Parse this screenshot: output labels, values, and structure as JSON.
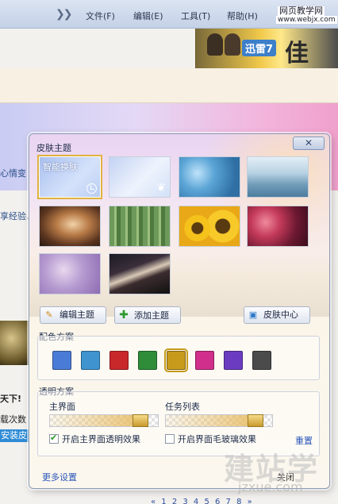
{
  "menu": {
    "items": [
      "文件(F)",
      "编辑(E)",
      "工具(T)",
      "帮助(H)"
    ],
    "brand_line1": "网页教学网",
    "brand_line2": "www.webjx.com"
  },
  "ad": {
    "logo": "迅雷7",
    "big": "佳"
  },
  "background": {
    "left_texts": [
      "心情变",
      "享经验、",
      "天下!",
      "载次数",
      "安装皮"
    ],
    "pager": "« 1 2 3 4 5 6 7 8 »"
  },
  "dialog": {
    "title": "皮肤主题",
    "close_icon": "close-x",
    "thumbnails": [
      {
        "label": "智能换肤",
        "kind": "auto",
        "icon": "clock-icon"
      },
      {
        "label": "",
        "kind": "light",
        "icon": "feather-icon"
      },
      {
        "label": "",
        "kind": "bokeh-blue"
      },
      {
        "label": "",
        "kind": "mountains"
      },
      {
        "label": "",
        "kind": "silk-swirl"
      },
      {
        "label": "",
        "kind": "bamboo"
      },
      {
        "label": "",
        "kind": "sunflowers"
      },
      {
        "label": "",
        "kind": "bokeh-red"
      },
      {
        "label": "",
        "kind": "lilac"
      },
      {
        "label": "",
        "kind": "light-streaks"
      }
    ],
    "buttons": {
      "edit_theme": "编辑主题",
      "add_theme": "添加主题",
      "skin_center": "皮肤中心"
    },
    "color_scheme": {
      "title": "配色方案",
      "colors": [
        "#4a7bd6",
        "#3f93cf",
        "#c9282a",
        "#2f8d3a",
        "#c79a1c",
        "#d12f8c",
        "#6b3cc0",
        "#4b4b4b"
      ],
      "selected_index": 4
    },
    "transparency": {
      "title": "透明方案",
      "main_label": "主界面",
      "task_label": "任务列表",
      "main_value": 0.9,
      "task_value": 0.9,
      "main_checkbox": "开启主界面透明效果",
      "main_checked": true,
      "glass_checkbox": "开启界面毛玻璃效果",
      "glass_checked": false,
      "reset": "重置"
    },
    "footer": {
      "more_settings": "更多设置",
      "close": "关闭"
    }
  },
  "watermark": {
    "line1": "建站学",
    "line2": "jzxue.com"
  }
}
